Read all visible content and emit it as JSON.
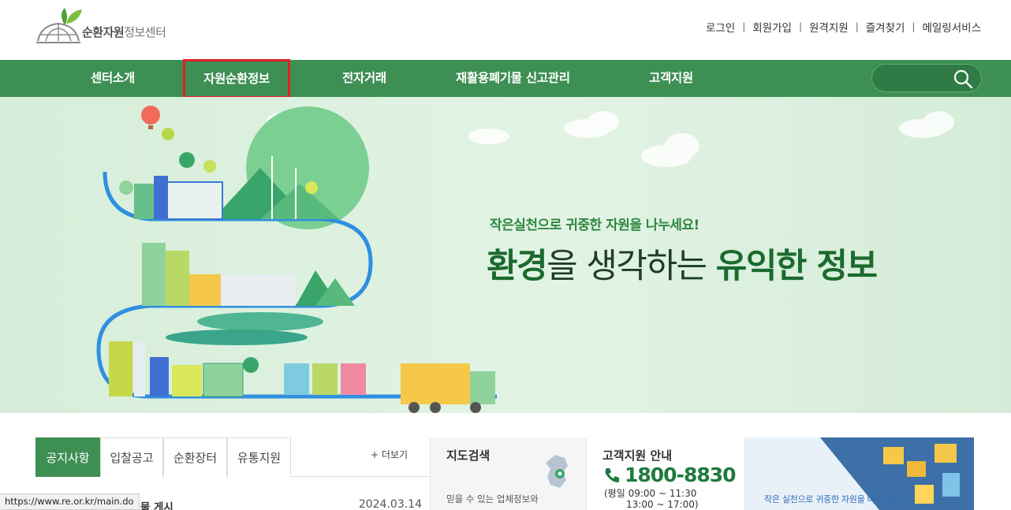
{
  "header": {
    "logo_bold": "순환자원",
    "logo_light": "정보센터",
    "util_links": [
      "로그인",
      "회원가입",
      "원격지원",
      "즐겨찾기",
      "메일링서비스"
    ]
  },
  "nav": {
    "items": [
      "센터소개",
      "자원순환정보",
      "전자거래",
      "재활용폐기물 신고관리",
      "고객지원"
    ],
    "active_index": 1,
    "search_placeholder": ""
  },
  "hero": {
    "subtitle": "작은실천으로 귀중한 자원을 나누세요!",
    "title_part1": "환경",
    "title_part2": "을 생각하는 ",
    "title_part3": "유익한 정보"
  },
  "notice": {
    "tabs": [
      "공지사항",
      "입찰공고",
      "순환장터",
      "유통지원"
    ],
    "more_label": "+ 더보기",
    "rows": [
      {
        "title": "홍보물 게시",
        "date": "2024.03.14"
      }
    ]
  },
  "map_panel": {
    "title": "지도검색",
    "desc": "믿을 수 있는 업체정보와"
  },
  "cs_panel": {
    "title": "고객지원 안내",
    "phone": "1800-8830",
    "hours1": "(평일 09:00 ~ 11:30",
    "hours2": "13:00 ~ 17:00)"
  },
  "banner": {
    "caption": "작은 실천으로 귀중한 자원을 나누세요!"
  },
  "status": {
    "url": "https://www.re.or.kr/main.do"
  },
  "colors": {
    "primary_green": "#3e8f54",
    "highlight_red": "#e41f2b",
    "phone_green": "#1e7a3d"
  }
}
